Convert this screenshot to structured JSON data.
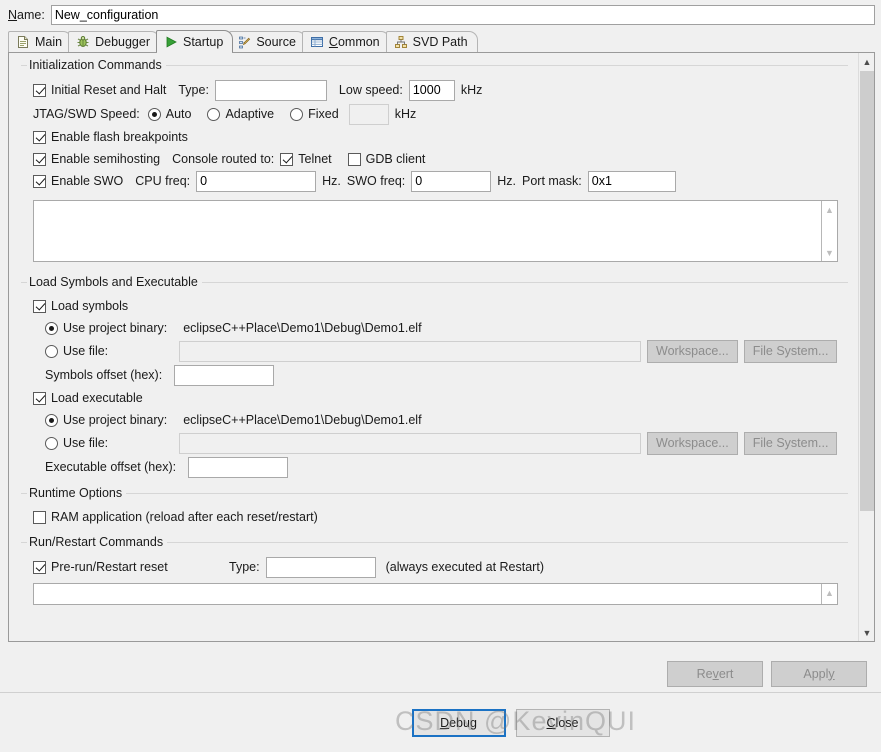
{
  "name_row": {
    "label_pre": "N",
    "label_key": "a",
    "label_post": "me:",
    "value": "New_configuration"
  },
  "tabs": [
    {
      "label": "Main",
      "icon": "document-icon",
      "active": false
    },
    {
      "label": "Debugger",
      "icon": "bug-icon",
      "active": false
    },
    {
      "label": "Startup",
      "icon": "play-icon",
      "active": true
    },
    {
      "label": "Source",
      "icon": "source-edit-icon",
      "active": false
    },
    {
      "label": "Common",
      "icon": "table-icon",
      "active": false
    },
    {
      "label": "SVD Path",
      "icon": "hierarchy-icon",
      "active": false
    }
  ],
  "init_group": {
    "legend": "Initialization Commands",
    "initial_reset_label": "Initial Reset and Halt",
    "initial_reset_checked": true,
    "type_label": "Type:",
    "type_value": "",
    "low_speed_label": "Low speed:",
    "low_speed_value": "1000",
    "low_speed_unit": "kHz",
    "jtag_label": "JTAG/SWD Speed:",
    "jtag_auto": "Auto",
    "jtag_adaptive": "Adaptive",
    "jtag_fixed": "Fixed",
    "jtag_selected": "Auto",
    "jtag_fixed_value": "",
    "jtag_fixed_unit": "kHz",
    "flash_bp_label": "Enable flash breakpoints",
    "flash_bp_checked": true,
    "semihosting_label": "Enable semihosting",
    "semihosting_checked": true,
    "console_routed_label": "Console routed to:",
    "telnet_label": "Telnet",
    "telnet_checked": true,
    "gdb_client_label": "GDB client",
    "gdb_client_checked": false,
    "swo_label": "Enable SWO",
    "swo_checked": true,
    "cpu_freq_label": "CPU freq:",
    "cpu_freq_value": "0",
    "cpu_freq_unit": "Hz.",
    "swo_freq_label": "SWO freq:",
    "swo_freq_value": "0",
    "swo_freq_unit": "Hz.",
    "port_mask_label": "Port mask:",
    "port_mask_value": "0x1",
    "commands_text": ""
  },
  "load_group": {
    "legend": "Load Symbols and Executable",
    "load_symbols_label": "Load symbols",
    "load_symbols_checked": true,
    "sym_use_project_label": "Use project binary:",
    "sym_use_project_selected": true,
    "sym_project_path": "eclipseC++Place\\Demo1\\Debug\\Demo1.elf",
    "sym_use_file_label": "Use file:",
    "sym_use_file_selected": false,
    "sym_file_value": "",
    "sym_workspace_button": "Workspace...",
    "sym_filesystem_button": "File System...",
    "sym_offset_label": "Symbols offset (hex):",
    "sym_offset_value": "",
    "load_exec_label": "Load executable",
    "load_exec_checked": true,
    "exe_use_project_label": "Use project binary:",
    "exe_use_project_selected": true,
    "exe_project_path": "eclipseC++Place\\Demo1\\Debug\\Demo1.elf",
    "exe_use_file_label": "Use file:",
    "exe_use_file_selected": false,
    "exe_file_value": "",
    "exe_workspace_button": "Workspace...",
    "exe_filesystem_button": "File System...",
    "exe_offset_label": "Executable offset (hex):",
    "exe_offset_value": ""
  },
  "runtime_group": {
    "legend": "Runtime Options",
    "ram_app_label": "RAM application (reload after each reset/restart)",
    "ram_app_checked": false
  },
  "runrestart_group": {
    "legend": "Run/Restart Commands",
    "prerun_label": "Pre-run/Restart reset",
    "prerun_checked": true,
    "type_label": "Type:",
    "type_value": "",
    "note": "(always executed at Restart)",
    "commands_text": ""
  },
  "buttonbar": {
    "revert": "Revert",
    "revert_key": "v",
    "apply": "Apply",
    "apply_key": "y"
  },
  "footer": {
    "debug_pre": "",
    "debug_key": "D",
    "debug_post": "ebug",
    "debug_label": "Debug",
    "close_pre": "",
    "close_key": "C",
    "close_post": "lose",
    "close_label": "Close"
  },
  "watermark": {
    "text": "CSDN @KevinQUI"
  },
  "scrollbar": {
    "up_glyph": "▲",
    "down_glyph": "▼"
  },
  "colors": {
    "window_bg": "#f0f0f0",
    "field_bg": "#ffffff",
    "border": "#a9a9a9",
    "default_button_border": "#1b72c4",
    "disabled_text": "#8c8c8c"
  }
}
